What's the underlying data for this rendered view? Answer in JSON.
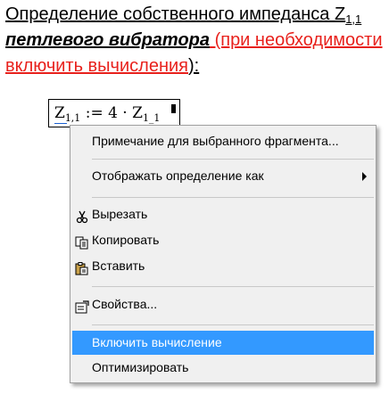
{
  "heading": {
    "part1": "Определение  собственного импеданса Z",
    "part1_sub": "1,1",
    "part2": "петлевого вибратора",
    "part3": " (при необходимости включить вычисления",
    "part4": "):"
  },
  "math": {
    "lhs": "Z",
    "lhs_sub": "1,1",
    "assign": " := 4 · Z",
    "rhs_sub": "1_1"
  },
  "context_menu": {
    "items": [
      {
        "label": "Примечание для выбранного фрагмента...",
        "icon": null
      },
      {
        "label": "Отображать определение как",
        "icon": "submenu-arrow"
      },
      {
        "label": "Вырезать",
        "icon": "scissors-icon"
      },
      {
        "label": "Копировать",
        "icon": "copy-icon"
      },
      {
        "label": "Вставить",
        "icon": "paste-icon"
      },
      {
        "label": "Свойства...",
        "icon": "properties-icon"
      },
      {
        "label": "Включить вычисление",
        "icon": null,
        "highlighted": true
      },
      {
        "label": "Оптимизировать",
        "icon": null
      }
    ]
  },
  "colors": {
    "highlight": "#3399ff",
    "red_text": "#e8211c",
    "menu_bg": "#f0f0f0"
  }
}
